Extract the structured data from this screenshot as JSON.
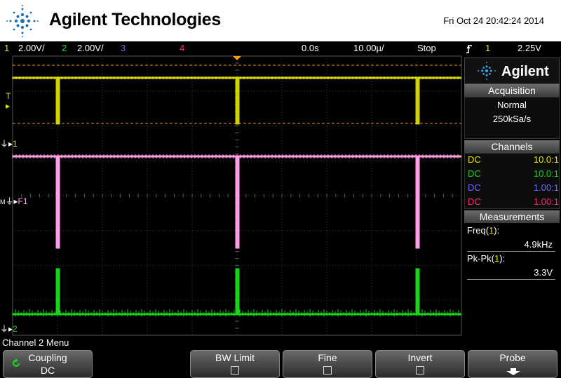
{
  "header": {
    "brand": "Agilent Technologies",
    "datetime": "Fri Oct 24 20:42:24 2014"
  },
  "status_bar": {
    "ch1_num": "1",
    "ch1_scale": "2.00V/",
    "ch2_num": "2",
    "ch2_scale": "2.00V/",
    "ch3_num": "3",
    "ch4_num": "4",
    "delay": "0.0s",
    "timebase": "10.00µ/",
    "run_state": "Stop",
    "trigger_source": "1",
    "trigger_level": "2.25V"
  },
  "markers": {
    "trigger": "T",
    "ch1": "1",
    "math": "F1",
    "ch2": "2"
  },
  "panel": {
    "brand": "Agilent",
    "acquisition_title": "Acquisition",
    "acq_mode": "Normal",
    "acq_rate": "250kSa/s",
    "channels_title": "Channels",
    "channels": [
      {
        "coupling": "DC",
        "probe": "10.0:1",
        "color": "#e8e800"
      },
      {
        "coupling": "DC",
        "probe": "10.0:1",
        "color": "#19d41b"
      },
      {
        "coupling": "DC",
        "probe": "1.00:1",
        "color": "#6b6bff"
      },
      {
        "coupling": "DC",
        "probe": "1.00:1",
        "color": "#ff2a6a"
      }
    ],
    "measurements_title": "Measurements",
    "meas": [
      {
        "label": "Freq(",
        "chan": "1",
        "close": "):",
        "value": "4.9kHz"
      },
      {
        "label": "Pk-Pk(",
        "chan": "1",
        "close": "):",
        "value": "3.3V"
      }
    ]
  },
  "menu_title": "Channel 2 Menu",
  "softkeys": {
    "coupling_label": "Coupling",
    "coupling_value": "DC",
    "bw_limit_label": "BW Limit",
    "fine_label": "Fine",
    "invert_label": "Invert",
    "probe_label": "Probe"
  },
  "colors": {
    "ch1": "#e8e800",
    "ch2": "#19d41b",
    "math": "#ff9ee6",
    "grid": "#3a3a3a"
  }
}
